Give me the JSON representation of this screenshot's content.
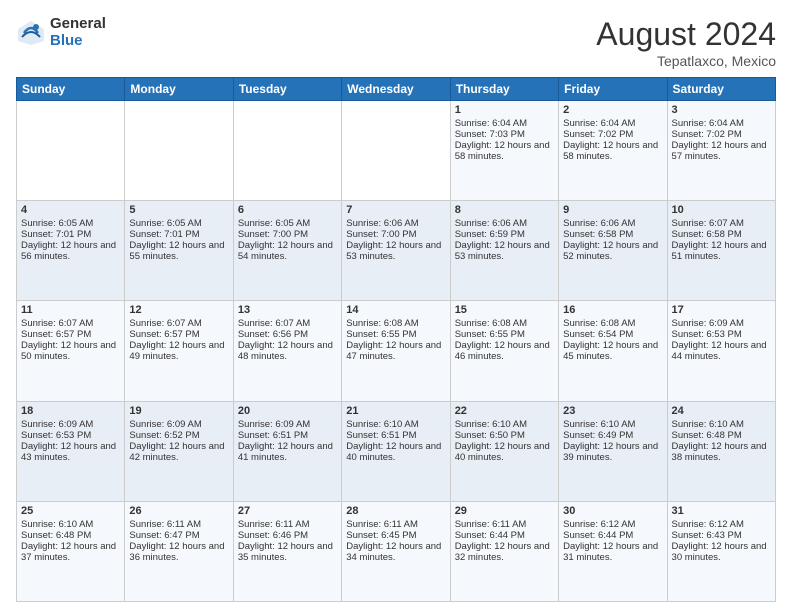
{
  "logo": {
    "general": "General",
    "blue": "Blue"
  },
  "title": {
    "month_year": "August 2024",
    "location": "Tepatlaxco, Mexico"
  },
  "days_of_week": [
    "Sunday",
    "Monday",
    "Tuesday",
    "Wednesday",
    "Thursday",
    "Friday",
    "Saturday"
  ],
  "weeks": [
    [
      {
        "day": "",
        "sunrise": "",
        "sunset": "",
        "daylight": ""
      },
      {
        "day": "",
        "sunrise": "",
        "sunset": "",
        "daylight": ""
      },
      {
        "day": "",
        "sunrise": "",
        "sunset": "",
        "daylight": ""
      },
      {
        "day": "",
        "sunrise": "",
        "sunset": "",
        "daylight": ""
      },
      {
        "day": "1",
        "sunrise": "Sunrise: 6:04 AM",
        "sunset": "Sunset: 7:03 PM",
        "daylight": "Daylight: 12 hours and 58 minutes."
      },
      {
        "day": "2",
        "sunrise": "Sunrise: 6:04 AM",
        "sunset": "Sunset: 7:02 PM",
        "daylight": "Daylight: 12 hours and 58 minutes."
      },
      {
        "day": "3",
        "sunrise": "Sunrise: 6:04 AM",
        "sunset": "Sunset: 7:02 PM",
        "daylight": "Daylight: 12 hours and 57 minutes."
      }
    ],
    [
      {
        "day": "4",
        "sunrise": "Sunrise: 6:05 AM",
        "sunset": "Sunset: 7:01 PM",
        "daylight": "Daylight: 12 hours and 56 minutes."
      },
      {
        "day": "5",
        "sunrise": "Sunrise: 6:05 AM",
        "sunset": "Sunset: 7:01 PM",
        "daylight": "Daylight: 12 hours and 55 minutes."
      },
      {
        "day": "6",
        "sunrise": "Sunrise: 6:05 AM",
        "sunset": "Sunset: 7:00 PM",
        "daylight": "Daylight: 12 hours and 54 minutes."
      },
      {
        "day": "7",
        "sunrise": "Sunrise: 6:06 AM",
        "sunset": "Sunset: 7:00 PM",
        "daylight": "Daylight: 12 hours and 53 minutes."
      },
      {
        "day": "8",
        "sunrise": "Sunrise: 6:06 AM",
        "sunset": "Sunset: 6:59 PM",
        "daylight": "Daylight: 12 hours and 53 minutes."
      },
      {
        "day": "9",
        "sunrise": "Sunrise: 6:06 AM",
        "sunset": "Sunset: 6:58 PM",
        "daylight": "Daylight: 12 hours and 52 minutes."
      },
      {
        "day": "10",
        "sunrise": "Sunrise: 6:07 AM",
        "sunset": "Sunset: 6:58 PM",
        "daylight": "Daylight: 12 hours and 51 minutes."
      }
    ],
    [
      {
        "day": "11",
        "sunrise": "Sunrise: 6:07 AM",
        "sunset": "Sunset: 6:57 PM",
        "daylight": "Daylight: 12 hours and 50 minutes."
      },
      {
        "day": "12",
        "sunrise": "Sunrise: 6:07 AM",
        "sunset": "Sunset: 6:57 PM",
        "daylight": "Daylight: 12 hours and 49 minutes."
      },
      {
        "day": "13",
        "sunrise": "Sunrise: 6:07 AM",
        "sunset": "Sunset: 6:56 PM",
        "daylight": "Daylight: 12 hours and 48 minutes."
      },
      {
        "day": "14",
        "sunrise": "Sunrise: 6:08 AM",
        "sunset": "Sunset: 6:55 PM",
        "daylight": "Daylight: 12 hours and 47 minutes."
      },
      {
        "day": "15",
        "sunrise": "Sunrise: 6:08 AM",
        "sunset": "Sunset: 6:55 PM",
        "daylight": "Daylight: 12 hours and 46 minutes."
      },
      {
        "day": "16",
        "sunrise": "Sunrise: 6:08 AM",
        "sunset": "Sunset: 6:54 PM",
        "daylight": "Daylight: 12 hours and 45 minutes."
      },
      {
        "day": "17",
        "sunrise": "Sunrise: 6:09 AM",
        "sunset": "Sunset: 6:53 PM",
        "daylight": "Daylight: 12 hours and 44 minutes."
      }
    ],
    [
      {
        "day": "18",
        "sunrise": "Sunrise: 6:09 AM",
        "sunset": "Sunset: 6:53 PM",
        "daylight": "Daylight: 12 hours and 43 minutes."
      },
      {
        "day": "19",
        "sunrise": "Sunrise: 6:09 AM",
        "sunset": "Sunset: 6:52 PM",
        "daylight": "Daylight: 12 hours and 42 minutes."
      },
      {
        "day": "20",
        "sunrise": "Sunrise: 6:09 AM",
        "sunset": "Sunset: 6:51 PM",
        "daylight": "Daylight: 12 hours and 41 minutes."
      },
      {
        "day": "21",
        "sunrise": "Sunrise: 6:10 AM",
        "sunset": "Sunset: 6:51 PM",
        "daylight": "Daylight: 12 hours and 40 minutes."
      },
      {
        "day": "22",
        "sunrise": "Sunrise: 6:10 AM",
        "sunset": "Sunset: 6:50 PM",
        "daylight": "Daylight: 12 hours and 40 minutes."
      },
      {
        "day": "23",
        "sunrise": "Sunrise: 6:10 AM",
        "sunset": "Sunset: 6:49 PM",
        "daylight": "Daylight: 12 hours and 39 minutes."
      },
      {
        "day": "24",
        "sunrise": "Sunrise: 6:10 AM",
        "sunset": "Sunset: 6:48 PM",
        "daylight": "Daylight: 12 hours and 38 minutes."
      }
    ],
    [
      {
        "day": "25",
        "sunrise": "Sunrise: 6:10 AM",
        "sunset": "Sunset: 6:48 PM",
        "daylight": "Daylight: 12 hours and 37 minutes."
      },
      {
        "day": "26",
        "sunrise": "Sunrise: 6:11 AM",
        "sunset": "Sunset: 6:47 PM",
        "daylight": "Daylight: 12 hours and 36 minutes."
      },
      {
        "day": "27",
        "sunrise": "Sunrise: 6:11 AM",
        "sunset": "Sunset: 6:46 PM",
        "daylight": "Daylight: 12 hours and 35 minutes."
      },
      {
        "day": "28",
        "sunrise": "Sunrise: 6:11 AM",
        "sunset": "Sunset: 6:45 PM",
        "daylight": "Daylight: 12 hours and 34 minutes."
      },
      {
        "day": "29",
        "sunrise": "Sunrise: 6:11 AM",
        "sunset": "Sunset: 6:44 PM",
        "daylight": "Daylight: 12 hours and 32 minutes."
      },
      {
        "day": "30",
        "sunrise": "Sunrise: 6:12 AM",
        "sunset": "Sunset: 6:44 PM",
        "daylight": "Daylight: 12 hours and 31 minutes."
      },
      {
        "day": "31",
        "sunrise": "Sunrise: 6:12 AM",
        "sunset": "Sunset: 6:43 PM",
        "daylight": "Daylight: 12 hours and 30 minutes."
      }
    ]
  ]
}
